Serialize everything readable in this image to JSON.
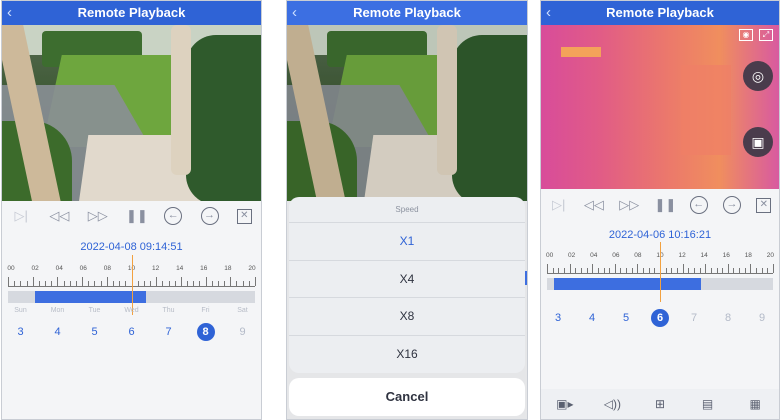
{
  "title": "Remote Playback",
  "colors": {
    "header": "#2f63d6",
    "accent": "#2f63d6",
    "timeline_cursor": "#f2a140"
  },
  "icons": {
    "back": "chevron-left-icon",
    "controls": [
      "step-frame-icon",
      "rewind-icon",
      "fast-forward-icon",
      "pause-icon",
      "prev-arrow-icon",
      "next-arrow-icon",
      "close-box-icon"
    ],
    "thermal": [
      "camera-icon",
      "record-icon"
    ],
    "bottom": [
      "camera-switch-icon",
      "volume-icon",
      "grid-icon",
      "list-icon",
      "calendar-icon"
    ]
  },
  "timeline_labels": [
    "00",
    "02",
    "04",
    "06",
    "08",
    "10",
    "12",
    "14",
    "16",
    "18",
    "20"
  ],
  "panels": {
    "left": {
      "datetime": "2022-04-08 09:14:51",
      "days": [
        {
          "name": "Sun",
          "num": "3"
        },
        {
          "name": "Mon",
          "num": "4"
        },
        {
          "name": "Tue",
          "num": "5"
        },
        {
          "name": "Wed",
          "num": "6"
        },
        {
          "name": "Thu",
          "num": "7"
        },
        {
          "name": "Fri",
          "num": "8",
          "selected": true
        },
        {
          "name": "Sat",
          "num": "9",
          "muted": true
        }
      ]
    },
    "middle": {
      "sheet_title": "Speed",
      "options": [
        "X1",
        "X4",
        "X8",
        "X16"
      ],
      "selected_option": "X1",
      "cancel_label": "Cancel"
    },
    "right": {
      "datetime": "2022-04-06 10:16:21",
      "days": [
        {
          "num": "3"
        },
        {
          "num": "4"
        },
        {
          "num": "5"
        },
        {
          "num": "6",
          "selected": true
        },
        {
          "num": "7",
          "muted": true
        },
        {
          "num": "8",
          "muted": true
        },
        {
          "num": "9",
          "muted": true
        }
      ]
    }
  }
}
